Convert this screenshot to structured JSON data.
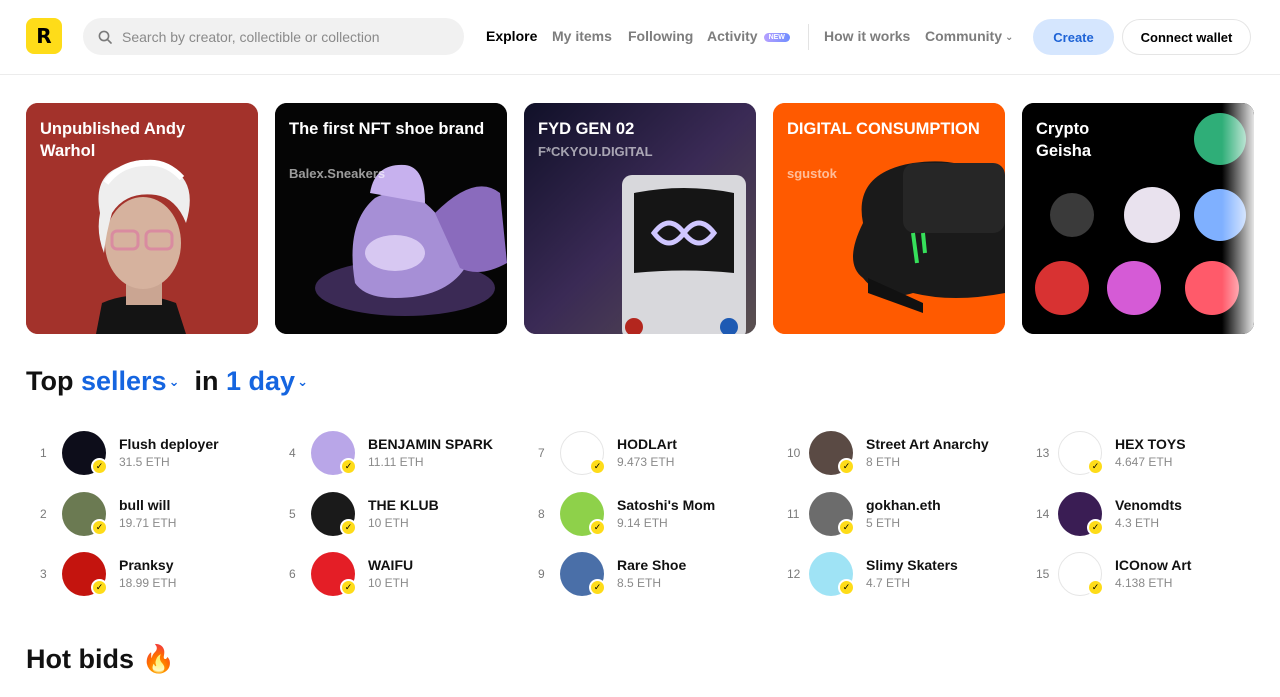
{
  "header": {
    "logo_letter": "R",
    "search_placeholder": "Search by creator, collectible or collection",
    "nav": {
      "explore": "Explore",
      "my_items": "My items",
      "following": "Following",
      "activity": "Activity",
      "activity_badge": "NEW",
      "how_it_works": "How it works",
      "community": "Community"
    },
    "create_label": "Create",
    "wallet_label": "Connect wallet"
  },
  "featured": [
    {
      "title": "Unpublished Andy Warhol",
      "subtitle": "",
      "bg": "#a3322b"
    },
    {
      "title": "The first NFT shoe brand",
      "subtitle": "Balex.Sneakers",
      "bg": "#050505"
    },
    {
      "title": "FYD GEN 02",
      "subtitle": "F*CKYOU.DIGITAL",
      "bg": "#2a2a3a"
    },
    {
      "title": "DIGITAL CONSUMPTION",
      "subtitle": "sgustok",
      "bg": "#ff5a00"
    },
    {
      "title": "Crypto Geisha",
      "subtitle": "",
      "bg": "#000000"
    }
  ],
  "top_sellers": {
    "prefix": "Top",
    "category": "sellers",
    "middle": "in",
    "period": "1 day",
    "items": [
      {
        "rank": "1",
        "name": "Flush deployer",
        "amount": "31.5 ETH",
        "color": "#0d0d1a"
      },
      {
        "rank": "2",
        "name": "bull will",
        "amount": "19.71 ETH",
        "color": "#6b7a52"
      },
      {
        "rank": "3",
        "name": "Pranksy",
        "amount": "18.99 ETH",
        "color": "#c4140e"
      },
      {
        "rank": "4",
        "name": "BENJAMIN SPARK",
        "amount": "11.11 ETH",
        "color": "#b9a6e8"
      },
      {
        "rank": "5",
        "name": "THE KLUB",
        "amount": "10 ETH",
        "color": "#1a1a1a"
      },
      {
        "rank": "6",
        "name": "WAIFU",
        "amount": "10 ETH",
        "color": "#e41e26"
      },
      {
        "rank": "7",
        "name": "HODLArt",
        "amount": "9.473 ETH",
        "color": "#ffffff"
      },
      {
        "rank": "8",
        "name": "Satoshi's Mom",
        "amount": "9.14 ETH",
        "color": "#8ed14a"
      },
      {
        "rank": "9",
        "name": "Rare Shoe",
        "amount": "8.5 ETH",
        "color": "#4a6fa8"
      },
      {
        "rank": "10",
        "name": "Street Art Anarchy",
        "amount": "8 ETH",
        "color": "#5a4a44"
      },
      {
        "rank": "11",
        "name": "gokhan.eth",
        "amount": "5 ETH",
        "color": "#6c6c6c"
      },
      {
        "rank": "12",
        "name": "Slimy Skaters",
        "amount": "4.7 ETH",
        "color": "#9fe3f5"
      },
      {
        "rank": "13",
        "name": "HEX TOYS",
        "amount": "4.647 ETH",
        "color": "#ffffff"
      },
      {
        "rank": "14",
        "name": "Venomdts",
        "amount": "4.3 ETH",
        "color": "#3a1d54"
      },
      {
        "rank": "15",
        "name": "ICOnow Art",
        "amount": "4.138 ETH",
        "color": "#ffffff"
      }
    ]
  },
  "hot_bids": {
    "title": "Hot bids",
    "emoji": "🔥"
  },
  "colors": {
    "accent": "#1565e0",
    "brand_yellow": "#fedc19",
    "create_bg": "#d5e6fe"
  }
}
